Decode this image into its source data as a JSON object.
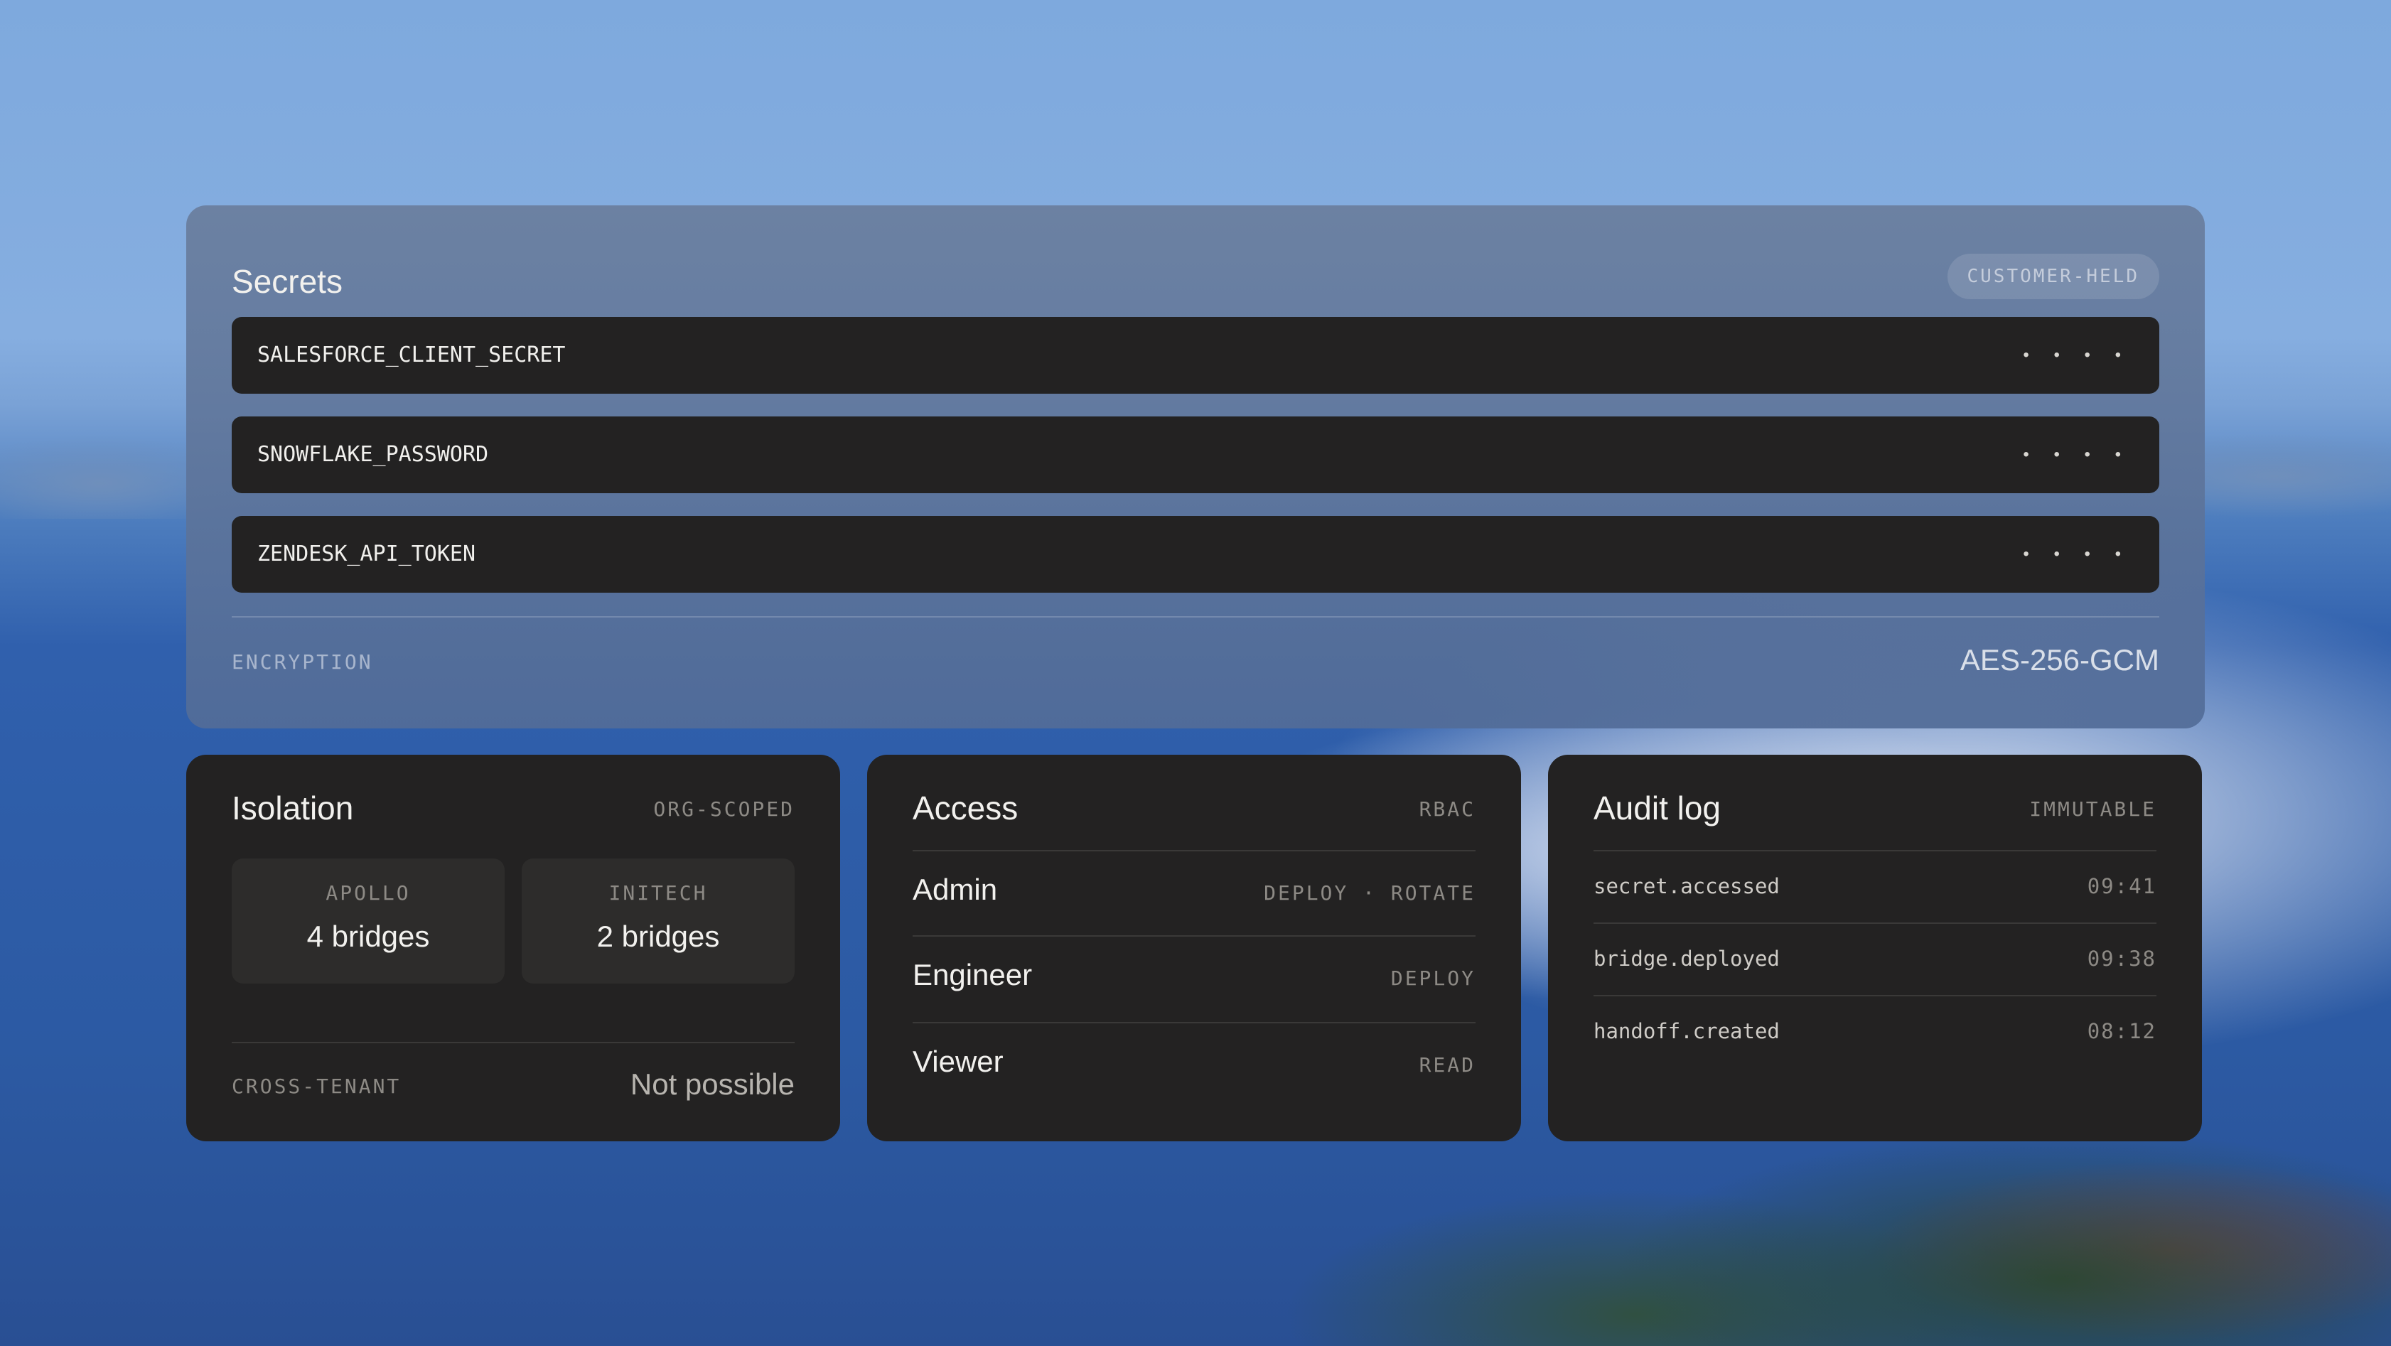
{
  "secrets": {
    "title": "Secrets",
    "badge": "CUSTOMER-HELD",
    "items": [
      {
        "name": "SALESFORCE_CLIENT_SECRET",
        "mask": "• • • •"
      },
      {
        "name": "SNOWFLAKE_PASSWORD",
        "mask": "• • • •"
      },
      {
        "name": "ZENDESK_API_TOKEN",
        "mask": "• • • •"
      }
    ],
    "encryption_label": "ENCRYPTION",
    "encryption_value": "AES-256-GCM"
  },
  "isolation": {
    "title": "Isolation",
    "tag": "ORG-SCOPED",
    "tenants": [
      {
        "name": "APOLLO",
        "count": "4 bridges"
      },
      {
        "name": "INITECH",
        "count": "2 bridges"
      }
    ],
    "cross_label": "CROSS-TENANT",
    "cross_value": "Not possible"
  },
  "access": {
    "title": "Access",
    "tag": "RBAC",
    "roles": [
      {
        "name": "Admin",
        "perms": "DEPLOY · ROTATE"
      },
      {
        "name": "Engineer",
        "perms": "DEPLOY"
      },
      {
        "name": "Viewer",
        "perms": "READ"
      }
    ]
  },
  "audit": {
    "title": "Audit log",
    "tag": "IMMUTABLE",
    "events": [
      {
        "event": "secret.accessed",
        "time": "09:41"
      },
      {
        "event": "bridge.deployed",
        "time": "09:38"
      },
      {
        "event": "handoff.created",
        "time": "08:12"
      }
    ]
  }
}
